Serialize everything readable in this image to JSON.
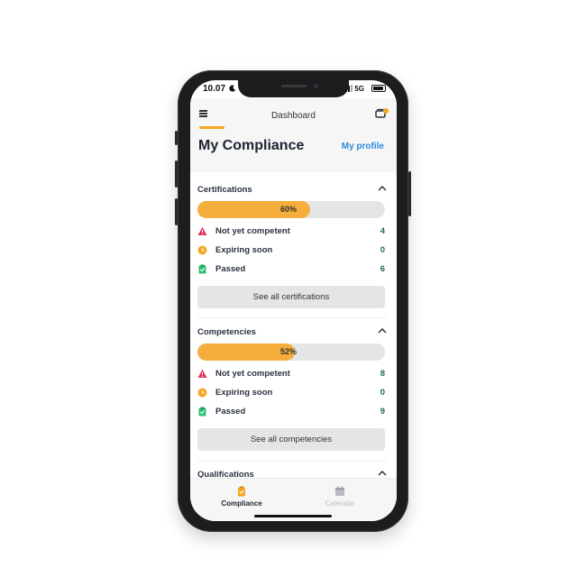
{
  "status_bar": {
    "time": "10.07",
    "network": "5G"
  },
  "header": {
    "title": "Dashboard",
    "page_title": "My Compliance",
    "profile_link": "My profile"
  },
  "colors": {
    "accent": "#f5a623",
    "link": "#2d8ad6",
    "count": "#1f6e45",
    "warning": "#e0365a",
    "expiring": "#f5a623",
    "passed": "#2fbf71"
  },
  "sections": [
    {
      "title": "Certifications",
      "progress": 60,
      "progress_label": "60%",
      "rows": [
        {
          "label": "Not yet competent",
          "count": "4",
          "icon": "warning-triangle-icon"
        },
        {
          "label": "Expiring soon",
          "count": "0",
          "icon": "clock-icon"
        },
        {
          "label": "Passed",
          "count": "6",
          "icon": "clipboard-check-icon"
        }
      ],
      "button": "See all certifications"
    },
    {
      "title": "Competencies",
      "progress": 52,
      "progress_label": "52%",
      "rows": [
        {
          "label": "Not yet competent",
          "count": "8",
          "icon": "warning-triangle-icon"
        },
        {
          "label": "Expiring soon",
          "count": "0",
          "icon": "clock-icon"
        },
        {
          "label": "Passed",
          "count": "9",
          "icon": "clipboard-check-icon"
        }
      ],
      "button": "See all competencies"
    },
    {
      "title": "Qualifications"
    }
  ],
  "bottom_nav": [
    {
      "label": "Compliance",
      "active": true,
      "icon": "clipboard-icon"
    },
    {
      "label": "Calendar",
      "active": false,
      "icon": "calendar-icon"
    }
  ]
}
